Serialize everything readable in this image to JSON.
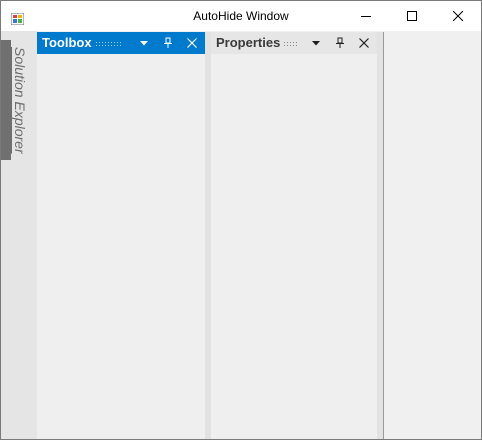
{
  "window": {
    "title": "AutoHide Window",
    "app_icon": "windows-forms-app-icon",
    "controls": {
      "minimize_icon": "minimize-icon",
      "maximize_icon": "maximize-icon",
      "close_icon": "close-icon"
    }
  },
  "autohide": {
    "tabs": [
      {
        "label": "Solution Explorer"
      }
    ]
  },
  "panels": {
    "toolbox": {
      "title": "Toolbox",
      "header_color": "#007acc",
      "buttons": [
        "dropdown-arrow-icon",
        "pin-icon",
        "close-icon"
      ]
    },
    "properties": {
      "title": "Properties",
      "header_color": "#e6e6e6",
      "buttons": [
        "dropdown-arrow-icon",
        "pin-icon",
        "close-icon"
      ]
    }
  },
  "colors": {
    "accent": "#007acc",
    "autohide_tab": "#707070",
    "background": "#f0f0f0"
  }
}
